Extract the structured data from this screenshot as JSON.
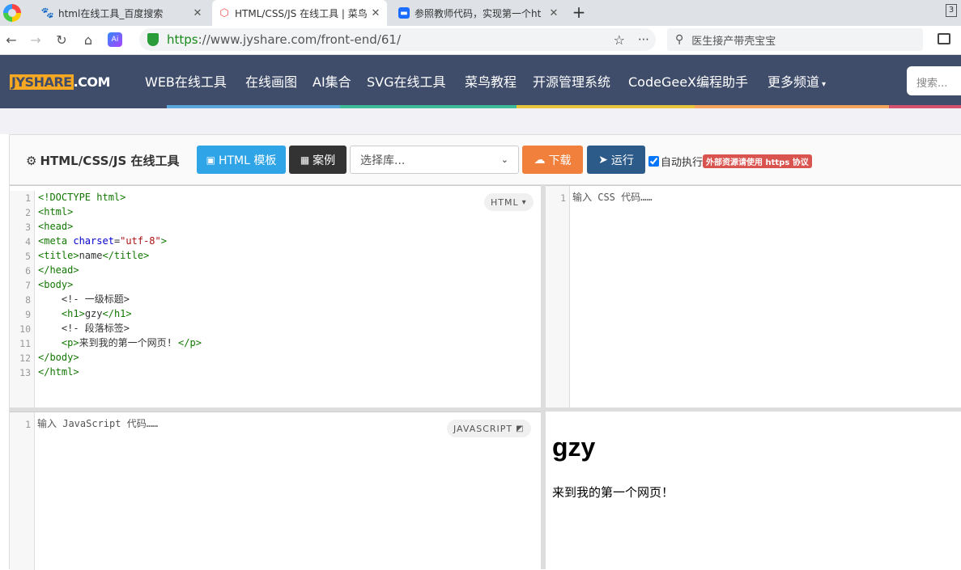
{
  "browser": {
    "tabs": [
      {
        "label": "html在线工具_百度搜索",
        "active": false
      },
      {
        "label": "HTML/CSS/JS 在线工具 | 菜鸟",
        "active": true
      },
      {
        "label": "参照教师代码，实现第一个ht",
        "active": false
      }
    ],
    "new_tab": "+",
    "tab_count": "3",
    "url_scheme": "https",
    "url_rest": "://www.jyshare.com/front-end/61/",
    "search_text": "医生接产带壳宝宝",
    "ai_label": "Ai"
  },
  "site": {
    "logo_left": "JYSHARE",
    "logo_right": ".COM",
    "nav": [
      "WEB在线工具",
      "在线画图",
      "AI集合",
      "SVG在线工具",
      "菜鸟教程",
      "开源管理系统",
      "CodeGeeX编程助手",
      "更多频道"
    ],
    "search_placeholder": "搜索..."
  },
  "toolbar": {
    "title": "HTML/CSS/JS 在线工具",
    "html_template": "HTML 模板",
    "examples": "案例",
    "library_placeholder": "选择库...",
    "download": "下载",
    "run": "运行",
    "auto_run": "自动执行",
    "https_note": "外部资源请使用 https 协议"
  },
  "html_editor": {
    "badge": "HTML",
    "lines": [
      "1",
      "2",
      "3",
      "4",
      "5",
      "6",
      "7",
      "8",
      "9",
      "10",
      "11",
      "12",
      "13"
    ]
  },
  "css_editor": {
    "line": "1",
    "placeholder": "输入 CSS 代码……"
  },
  "js_editor": {
    "line": "1",
    "placeholder": "输入 JavaScript 代码……",
    "badge": "JAVASCRIPT"
  },
  "preview": {
    "heading": "gzy",
    "paragraph": "来到我的第一个网页！"
  },
  "colors": {
    "header": "#3f4d6b",
    "html_btn": "#2fa4e7",
    "dark_btn": "#333333",
    "download_btn": "#f0803c",
    "run_btn": "#2c5b8a",
    "note_bg": "#d9534f"
  }
}
